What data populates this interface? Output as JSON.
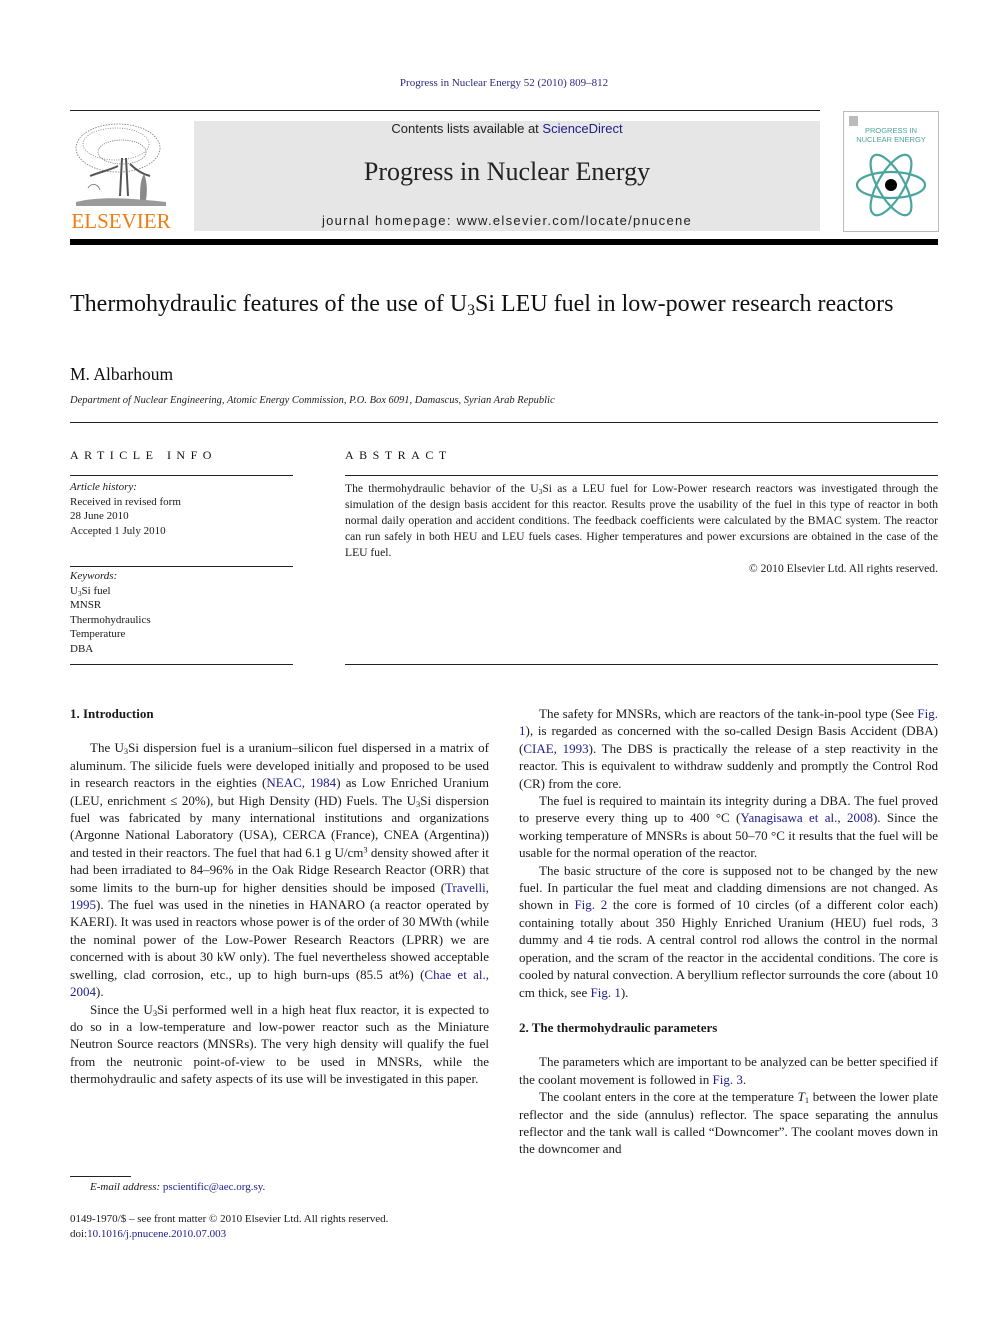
{
  "header": {
    "citation": "Progress in Nuclear Energy 52 (2010) 809–812",
    "publisher_logo_text": "ELSEVIER",
    "contents_prefix": "Contents lists available at ",
    "contents_link": "ScienceDirect",
    "journal_name": "Progress in Nuclear Energy",
    "homepage_prefix": "journal homepage: ",
    "homepage_url": "www.elsevier.com/locate/pnucene",
    "cover_title_line1": "PROGRESS IN",
    "cover_title_line2": "NUCLEAR ENERGY",
    "colors": {
      "elsevier_orange": "#f07d13",
      "link_blue": "#1c1c8a",
      "cover_teal": "#4aa59e",
      "banner_gray": "#e6e6e6"
    }
  },
  "article": {
    "title_part1": "Thermohydraulic features of the use of U",
    "title_sub": "3",
    "title_part2": "Si LEU fuel in low-power research reactors",
    "author": "M. Albarhoum",
    "affiliation": "Department of Nuclear Engineering, Atomic Energy Commission, P.O. Box 6091, Damascus, Syrian Arab Republic"
  },
  "article_info": {
    "heading": "ARTICLE INFO",
    "history_label": "Article history:",
    "history_lines": [
      "Received in revised form",
      "28 June 2010",
      "Accepted 1 July 2010"
    ],
    "keywords_label": "Keywords:",
    "keyword_1_pre": "U",
    "keyword_1_sub": "3",
    "keyword_1_post": "Si fuel",
    "keywords_rest": [
      "MNSR",
      "Thermohydraulics",
      "Temperature",
      "DBA"
    ]
  },
  "abstract": {
    "heading": "ABSTRACT",
    "text_pre": "The thermohydraulic behavior of the U",
    "text_sub": "3",
    "text_post": "Si as a LEU fuel for Low-Power research reactors was investigated through the simulation of the design basis accident for this reactor. Results prove the usability of the fuel in this type of reactor in both normal daily operation and accident conditions. The feedback coefficients were calculated by the BMAC system. The reactor can run safely in both HEU and LEU fuels cases. Higher temperatures and power excursions are obtained in the case of the LEU fuel.",
    "copyright": "© 2010 Elsevier Ltd. All rights reserved."
  },
  "sections": {
    "s1_heading": "1.  Introduction",
    "s1_p1": {
      "a": "The U",
      "sub1": "3",
      "b": "Si dispersion fuel is a uranium–silicon fuel dispersed in a matrix of aluminum. The silicide fuels were developed initially and proposed to be used in research reactors in the eighties (",
      "ref1": "NEAC, 1984",
      "c": ") as Low Enriched Uranium (LEU, enrichment ≤ 20%), but High Density (HD) Fuels. The U",
      "sub2": "3",
      "d": "Si dispersion fuel was fabricated by many international institutions and organizations (Argonne National Laboratory (USA), CERCA (France), CNEA (Argentina)) and tested in their reactors. The fuel that had 6.1 g U/cm",
      "sup1": "3",
      "e": " density showed after it had been irradiated to 84–96% in the Oak Ridge Research Reactor (ORR) that some limits to the burn-up for higher densities should be imposed (",
      "ref2": "Travelli, 1995",
      "f": "). The fuel was used in the nineties in HANARO (a reactor operated by KAERI). It was used in reactors whose power is of the order of 30 MWth (while the nominal power of the Low-Power Research Reactors (LPRR) we are concerned with is about 30 kW only). The fuel nevertheless showed acceptable swelling, clad corrosion, etc., up to high burn-ups (85.5 at%) (",
      "ref3": "Chae et al., 2004",
      "g": ")."
    },
    "s1_p2": {
      "a": "Since the U",
      "sub1": "3",
      "b": "Si performed well in a high heat flux reactor, it is expected to do so in a low-temperature and low-power reactor such as the Miniature Neutron Source reactors (MNSRs). The very high density will qualify the fuel from the neutronic point-of-view to be used in MNSRs, while the thermohydraulic and safety aspects of its use will be investigated in this paper."
    },
    "s1_p3": {
      "a": "The safety for MNSRs, which are reactors of the tank-in-pool type (See ",
      "ref1": "Fig. 1",
      "b": "), is regarded as concerned with the so-called Design Basis Accident (DBA) (",
      "ref2": "CIAE, 1993",
      "c": "). The DBS is practically the release of a step reactivity in the reactor. This is equivalent to withdraw suddenly and promptly the Control Rod (CR) from the core."
    },
    "s1_p4": {
      "a": "The fuel is required to maintain its integrity during a DBA. The fuel proved to preserve every thing up to 400 °C (",
      "ref1": "Yanagisawa et al., 2008",
      "b": "). Since the working temperature of MNSRs is about 50–70 °C it results that the fuel will be usable for the normal operation of the reactor."
    },
    "s1_p5": {
      "a": "The basic structure of the core is supposed not to be changed by the new fuel. In particular the fuel meat and cladding dimensions are not changed. As shown in ",
      "ref1": "Fig. 2",
      "b": " the core is formed of 10 circles (of a different color each) containing totally about 350 Highly Enriched Uranium (HEU) fuel rods, 3 dummy and 4 tie rods. A central control rod allows the control in the normal operation, and the scram of the reactor in the accidental conditions. The core is cooled by natural convection. A beryllium reflector surrounds the core (about 10 cm thick, see ",
      "ref2": "Fig. 1",
      "c": ")."
    },
    "s2_heading": "2.  The thermohydraulic parameters",
    "s2_p1": {
      "a": "The parameters which are important to be analyzed can be better specified if the coolant movement is followed in ",
      "ref1": "Fig. 3",
      "b": "."
    },
    "s2_p2": {
      "a": "The coolant enters in the core at the temperature ",
      "var": "T",
      "var_sub": "1",
      "b": " between the lower plate reflector and the side (annulus) reflector. The space separating the annulus reflector and the tank wall is called “Downcomer”. The coolant moves down in the downcomer and"
    }
  },
  "footnote": {
    "email_label": "E-mail address: ",
    "email": "pscientific@aec.org.sy",
    "email_end": "."
  },
  "front_matter": {
    "issn_line": "0149-1970/$ – see front matter © 2010 Elsevier Ltd. All rights reserved.",
    "doi_label": "doi:",
    "doi": "10.1016/j.pnucene.2010.07.003"
  }
}
